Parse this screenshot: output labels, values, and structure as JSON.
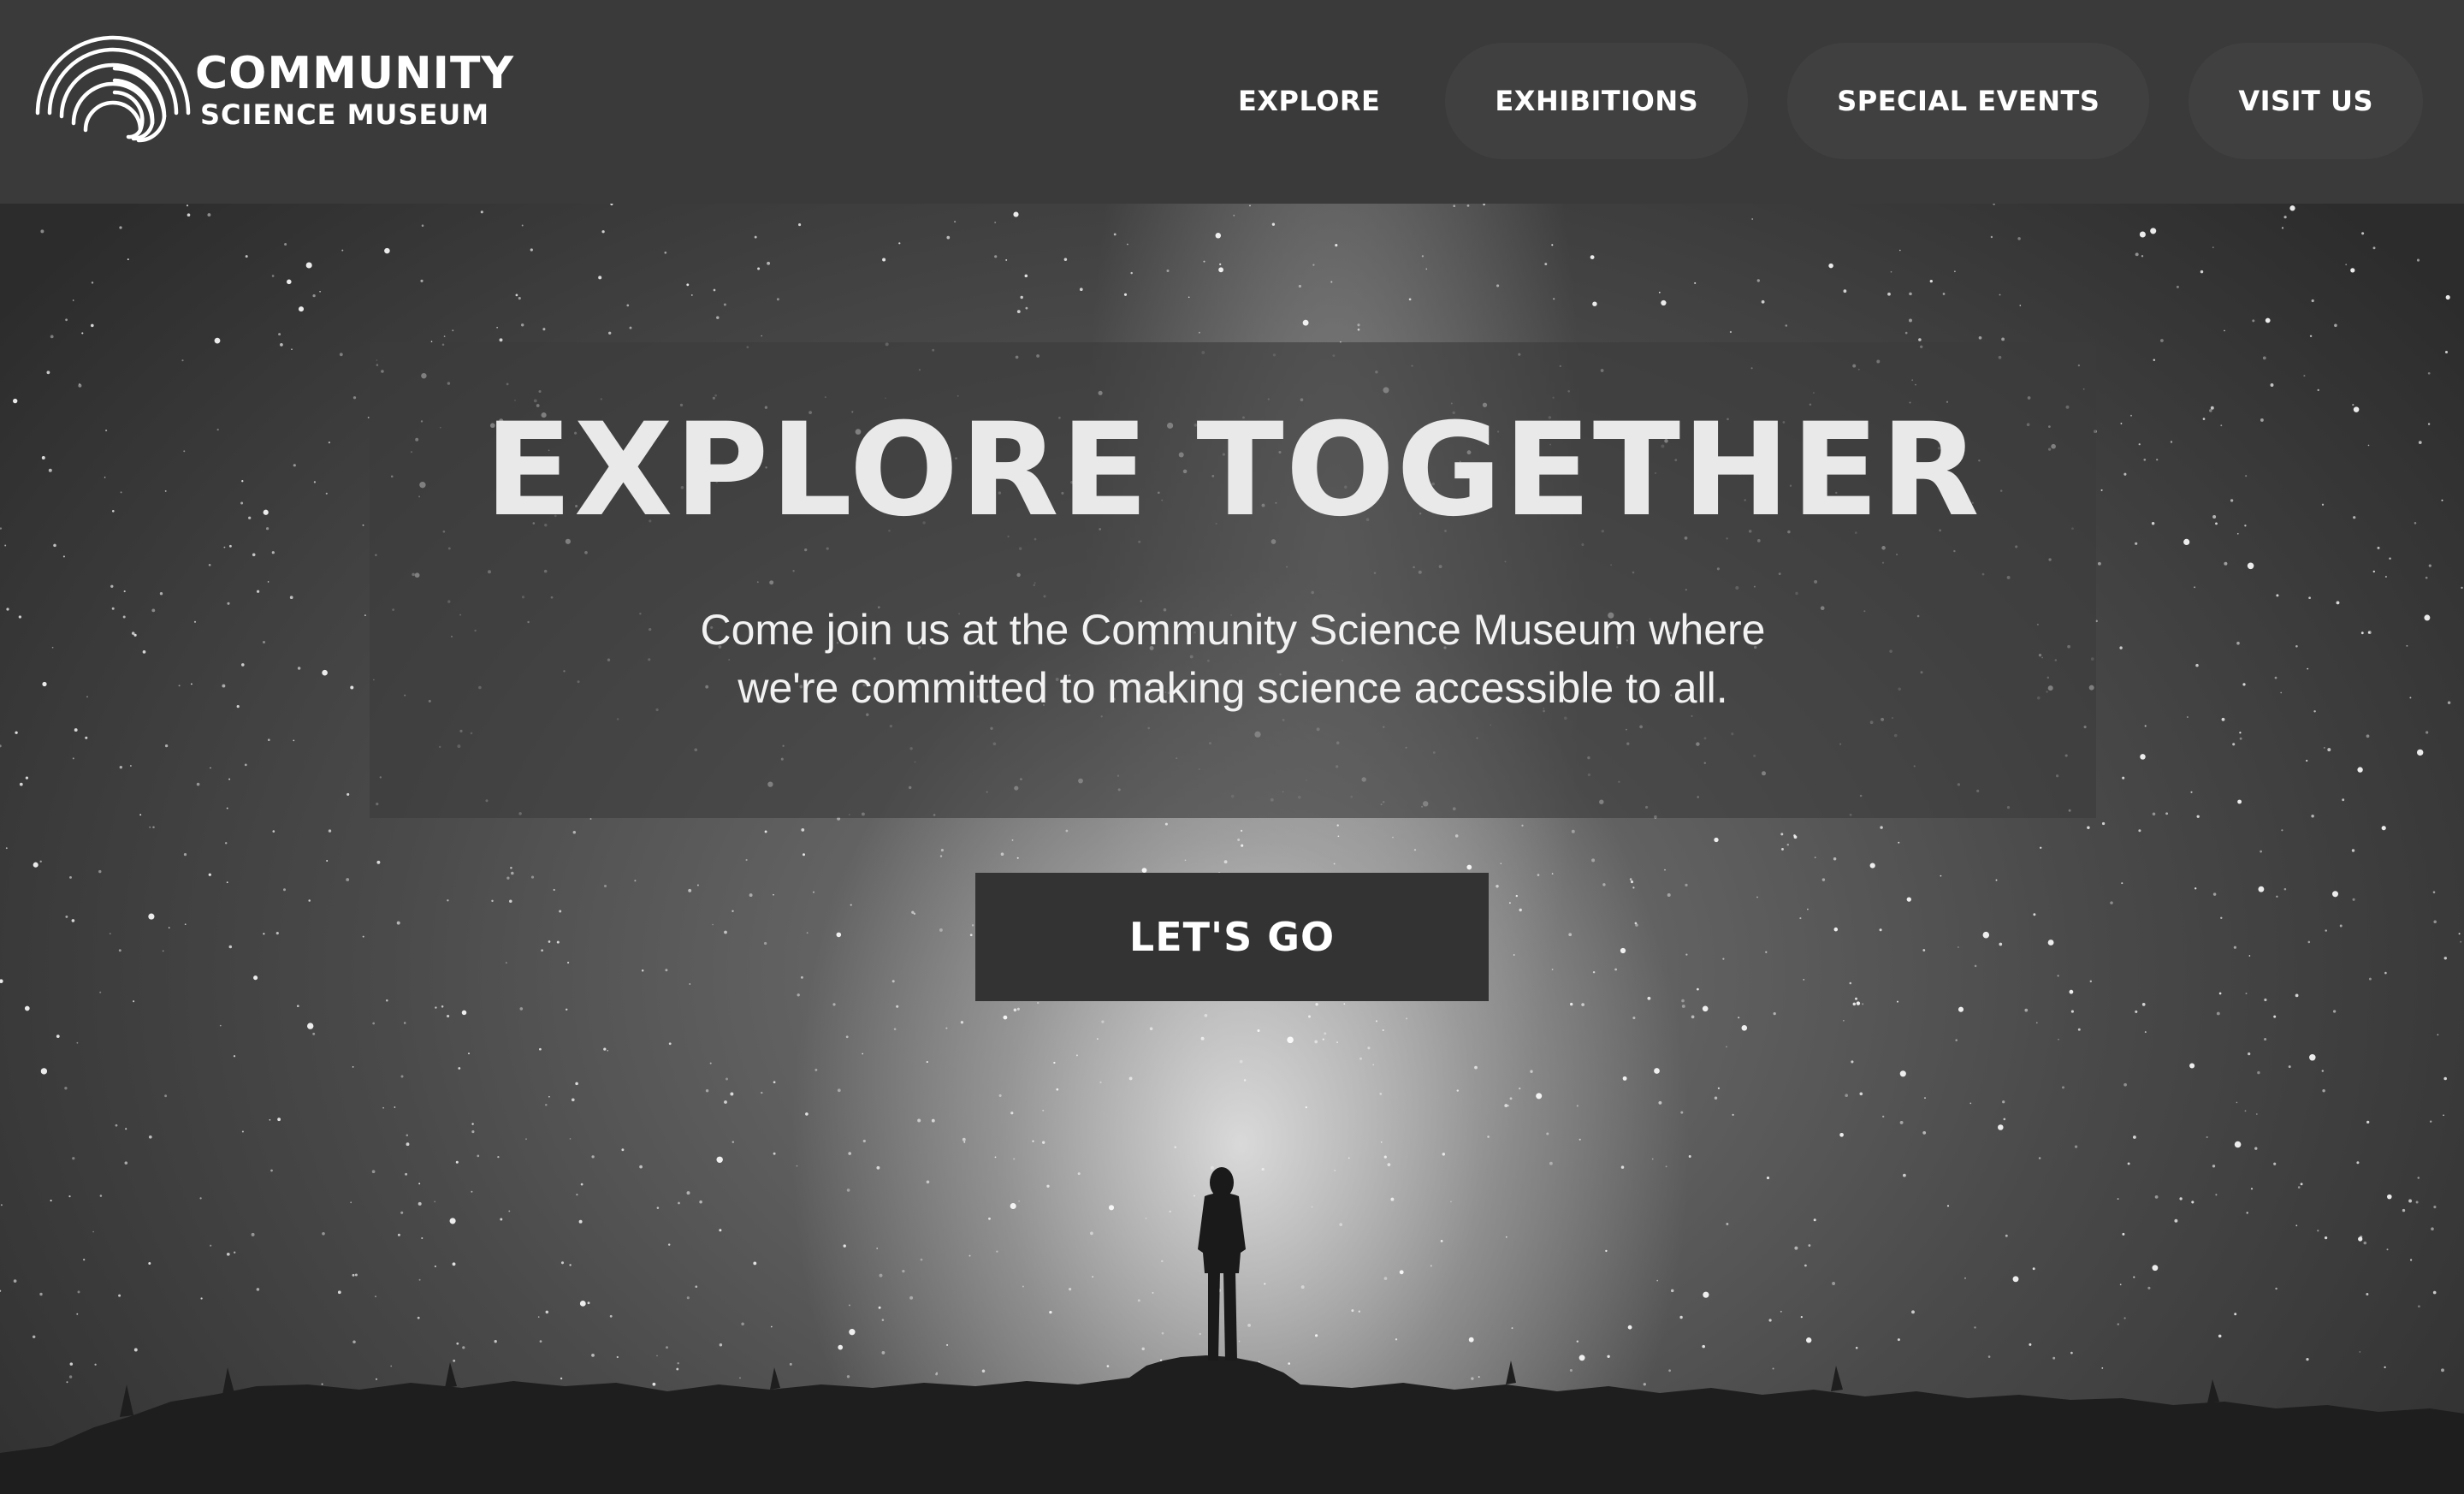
{
  "brand": {
    "name_line1": "COMMUNITY",
    "name_line2": "SCIENCE MUSEUM",
    "logo_icon": "concentric-arcs-logo-icon"
  },
  "nav": {
    "items": [
      {
        "label": "EXPLORE"
      },
      {
        "label": "EXHIBITIONS"
      },
      {
        "label": "SPECIAL EVENTS"
      },
      {
        "label": "VISIT US"
      }
    ]
  },
  "hero": {
    "title": "EXPLORE TOGETHER",
    "subtitle_line1": "Come join us at the Community Science Museum where",
    "subtitle_line2": "we're committed to making science accessible to all.",
    "cta_label": "LET'S GO",
    "background_image": "night-sky-milky-way-with-person-silhouette"
  },
  "colors": {
    "header_bg": "#3a3a3a",
    "nav_pill_bg": "#404040",
    "panel_bg": "rgba(60,60,60,0.62)",
    "button_bg": "#333333",
    "text_primary": "#ffffff",
    "title_text": "#e9e9e9"
  }
}
